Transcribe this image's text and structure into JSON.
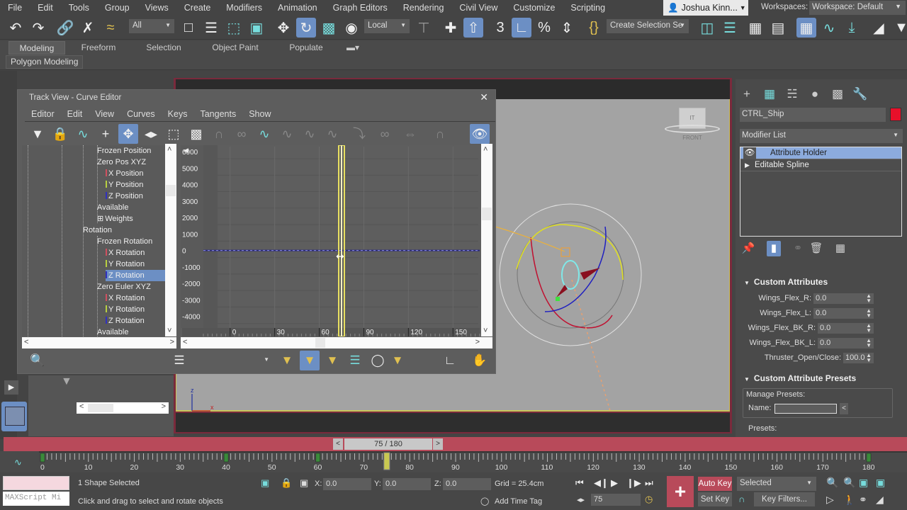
{
  "menubar": {
    "items": [
      "File",
      "Edit",
      "Tools",
      "Group",
      "Views",
      "Create",
      "Modifiers",
      "Animation",
      "Graph Editors",
      "Rendering",
      "Civil View",
      "Customize",
      "Scripting"
    ],
    "user": "Joshua Kinn...",
    "workspaces_label": "Workspaces:",
    "workspace": "Workspace: Default"
  },
  "toolbar": {
    "selection_filter": "All",
    "reference_coord": "Local",
    "named_selection": "Create Selection Se"
  },
  "ribbon": {
    "tabs": [
      "Modeling",
      "Freeform",
      "Selection",
      "Object Paint",
      "Populate"
    ],
    "active_tab": "Modeling",
    "panel": "Polygon Modeling"
  },
  "trackview": {
    "title": "Track View - Curve Editor",
    "menus": [
      "Editor",
      "Edit",
      "View",
      "Curves",
      "Keys",
      "Tangents",
      "Show"
    ],
    "tree": [
      {
        "label": "Frozen Position",
        "level": 1
      },
      {
        "label": "Zero Pos XYZ",
        "level": 1
      },
      {
        "label": "X Position",
        "level": 2,
        "axis": "x"
      },
      {
        "label": "Y Position",
        "level": 2,
        "axis": "y"
      },
      {
        "label": "Z Position",
        "level": 2,
        "axis": "z"
      },
      {
        "label": "Available",
        "level": 1
      },
      {
        "label": "Weights",
        "level": 1,
        "expandable": true
      },
      {
        "label": "Rotation",
        "level": 0
      },
      {
        "label": "Frozen Rotation",
        "level": 1
      },
      {
        "label": "X Rotation",
        "level": 2,
        "axis": "x"
      },
      {
        "label": "Y Rotation",
        "level": 2,
        "axis": "y"
      },
      {
        "label": "Z Rotation",
        "level": 2,
        "axis": "z",
        "selected": true
      },
      {
        "label": "Zero Euler XYZ",
        "level": 1
      },
      {
        "label": "X Rotation",
        "level": 2,
        "axis": "x"
      },
      {
        "label": "Y Rotation",
        "level": 2,
        "axis": "y"
      },
      {
        "label": "Z Rotation",
        "level": 2,
        "axis": "z"
      },
      {
        "label": "Available",
        "level": 1
      }
    ],
    "graph": {
      "y_ticks": [
        "6000",
        "5000",
        "4000",
        "3000",
        "2000",
        "1000",
        "0",
        "-1000",
        "-2000",
        "-3000",
        "-4000"
      ],
      "y_values": [
        6000,
        5000,
        4000,
        3000,
        2000,
        1000,
        0,
        -1000,
        -2000,
        -3000,
        -4000
      ],
      "x_ticks": [
        "0",
        "30",
        "60",
        "90",
        "120",
        "150"
      ],
      "x_values": [
        0,
        30,
        60,
        90,
        120,
        150
      ],
      "x_range": [
        -18,
        168
      ],
      "current_frame": 75,
      "curve_value": 0
    }
  },
  "command_panel": {
    "object_name": "CTRL_Ship",
    "object_color": "#e8102a",
    "modifier_list": "Modifier List",
    "stack": [
      {
        "label": "Attribute Holder",
        "selected": true
      },
      {
        "label": "Editable Spline",
        "selected": false
      }
    ],
    "custom_attributes_title": "Custom Attributes",
    "attributes": [
      {
        "label": "Wings_Flex_R:",
        "value": "0.0"
      },
      {
        "label": "Wings_Flex_L:",
        "value": "0.0"
      },
      {
        "label": "Wings_Flex_BK_R:",
        "value": "0.0"
      },
      {
        "label": "Wings_Flex_BK_L:",
        "value": "0.0"
      },
      {
        "label": "Thruster_Open/Close:",
        "value": "100.0"
      }
    ],
    "presets_title": "Custom Attribute Presets",
    "manage_presets": "Manage Presets:",
    "name_label": "Name:",
    "name_value": "",
    "presets_label": "Presets:"
  },
  "viewport": {
    "viewcube_label": "IT FRONT"
  },
  "timeline": {
    "readout": "75 / 180",
    "current": 75,
    "total": 180,
    "ticks": [
      "0",
      "10",
      "20",
      "30",
      "40",
      "50",
      "60",
      "70",
      "80",
      "90",
      "100",
      "110",
      "120",
      "130",
      "140",
      "150",
      "160",
      "170",
      "180"
    ],
    "keys": [
      0,
      40,
      60,
      180
    ]
  },
  "status": {
    "selection": "1 Shape Selected",
    "prompt": "Click and drag to select and rotate objects",
    "maxscript": "MAXScript Mi",
    "x": "0.0",
    "y": "0.0",
    "z": "0.0",
    "grid": "Grid = 25.4cm",
    "add_time_tag": "Add Time Tag",
    "frame": "75",
    "auto_key": "Auto Key",
    "set_key": "Set Key",
    "key_mode": "Selected",
    "key_filters": "Key Filters..."
  },
  "colors": {
    "accent_blue": "#6c8fc4",
    "autokey_red": "#b84a5a",
    "viewport_border": "#c9c55b"
  }
}
